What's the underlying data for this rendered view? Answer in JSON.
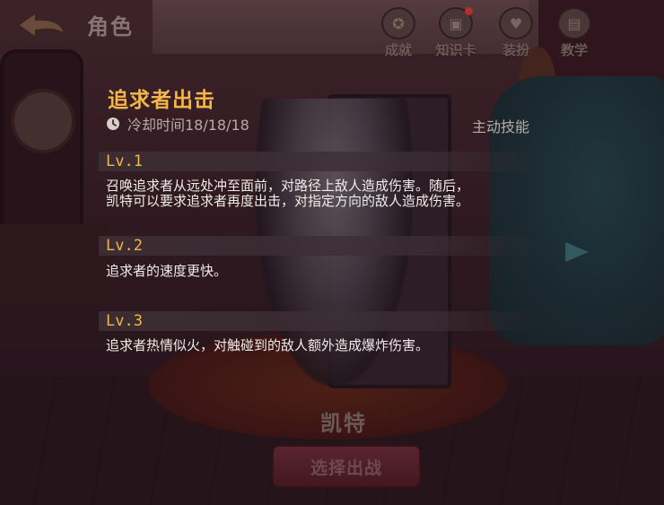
{
  "header": {
    "title": "角色",
    "back_icon": "back-arrow-icon",
    "menu": [
      {
        "label": "成就",
        "icon": "achievement-icon",
        "badge": false
      },
      {
        "label": "知识卡",
        "icon": "knowledge-card-icon",
        "badge": true
      },
      {
        "label": "装扮",
        "icon": "costume-icon",
        "badge": false
      },
      {
        "label": "教学",
        "icon": "tutorial-icon",
        "badge": false
      }
    ]
  },
  "skill": {
    "name": "追求者出击",
    "cooldown_text": "冷却时间18/18/18",
    "type": "主动技能",
    "levels": [
      {
        "label": "Lv.1",
        "desc_lines": [
          "召唤追求者从远处冲至面前，对路径上敌人造成伤害。随后，",
          "凯特可以要求追求者再度出击，对指定方向的敌人造成伤害。"
        ]
      },
      {
        "label": "Lv.2",
        "desc_lines": [
          "追求者的速度更快。"
        ]
      },
      {
        "label": "Lv.3",
        "desc_lines": [
          "追求者热情似火，对触碰到的敌人额外造成爆炸伤害。"
        ]
      }
    ]
  },
  "character": {
    "name": "凯特",
    "select_label": "选择出战"
  },
  "colors": {
    "accent_gold": "#f2b64a",
    "text_light": "#f0ece8",
    "text_muted": "#b8aca6"
  }
}
